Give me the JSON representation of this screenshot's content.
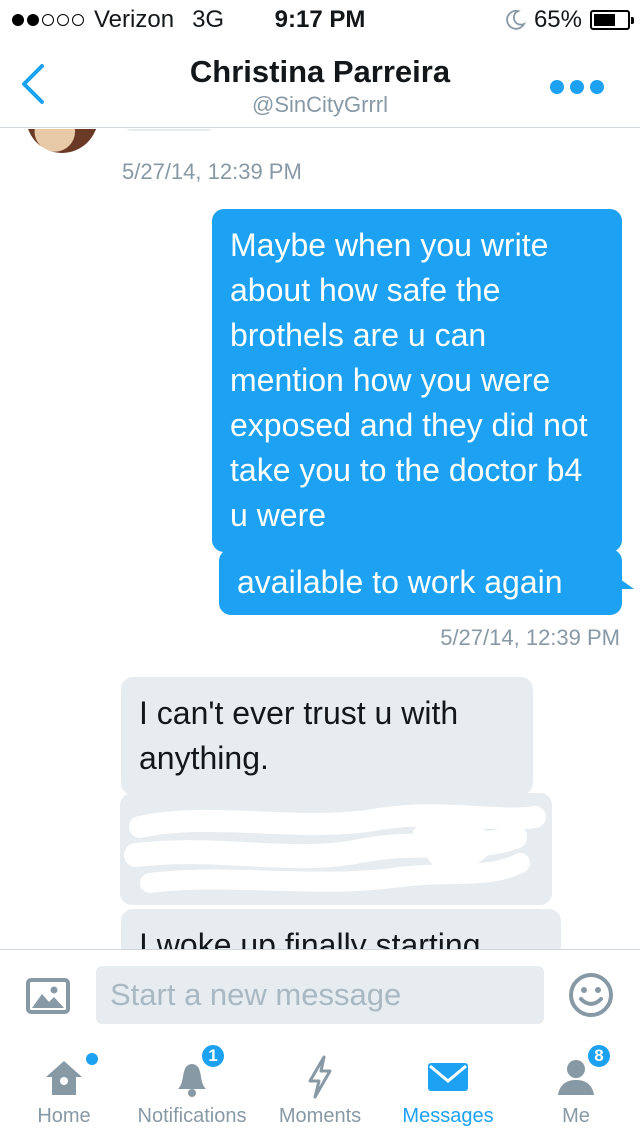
{
  "status_bar": {
    "carrier": "Verizon",
    "network": "3G",
    "time": "9:17 PM",
    "battery": "65%",
    "battery_level": 0.65,
    "signal_bars": 2
  },
  "navbar": {
    "title": "Christina Parreira",
    "handle": "@SinCityGrrrl",
    "back_icon": "chevron-left-icon",
    "more_icon": "more-dots-icon"
  },
  "conversation": {
    "messages": [
      {
        "direction": "incoming",
        "text": "",
        "timestamp": "5/27/14, 12:39 PM"
      },
      {
        "direction": "outgoing",
        "text": "Maybe when you write about how safe the brothels are u can mention how you were exposed and they did not take you to the doctor b4 u were"
      },
      {
        "direction": "outgoing",
        "text": "available to work again",
        "timestamp": "5/27/14, 12:39 PM"
      },
      {
        "direction": "incoming",
        "text": "I can't ever trust u with anything."
      },
      {
        "direction": "incoming",
        "text": "",
        "redacted": true
      },
      {
        "direction": "incoming",
        "text": "I woke up finally starting"
      }
    ]
  },
  "composer": {
    "placeholder": "Start a new message",
    "value": "",
    "photo_icon": "image-icon",
    "emoji_icon": "emoji-icon"
  },
  "tabs": [
    {
      "label": "Home",
      "icon": "home-icon",
      "new_indicator": true,
      "active": false
    },
    {
      "label": "Notifications",
      "icon": "bell-icon",
      "badge": "1",
      "active": false
    },
    {
      "label": "Moments",
      "icon": "lightning-icon",
      "active": false
    },
    {
      "label": "Messages",
      "icon": "envelope-icon",
      "active": true
    },
    {
      "label": "Me",
      "icon": "person-icon",
      "badge": "8",
      "active": false
    }
  ],
  "colors": {
    "accent": "#1da1f2",
    "incoming_bubble": "#e6ecf0",
    "muted_text": "#8899a6"
  }
}
